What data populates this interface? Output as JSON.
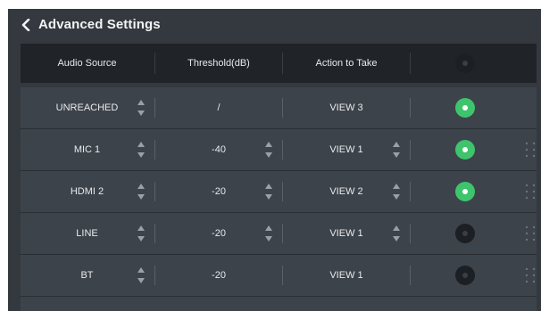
{
  "header": {
    "title": "Advanced Settings"
  },
  "table": {
    "columns": [
      "Audio Source",
      "Threshold(dB)",
      "Action to Take"
    ],
    "rows": [
      {
        "source": "UNREACHED",
        "threshold": "/",
        "action": "VIEW 3",
        "enabled": true
      },
      {
        "source": "MIC 1",
        "threshold": "-40",
        "action": "VIEW 1",
        "enabled": true
      },
      {
        "source": "HDMI 2",
        "threshold": "-20",
        "action": "VIEW 2",
        "enabled": true
      },
      {
        "source": "LINE",
        "threshold": "-20",
        "action": "VIEW 1",
        "enabled": false
      },
      {
        "source": "BT",
        "threshold": "-20",
        "action": "VIEW 1",
        "enabled": false
      }
    ]
  },
  "colors": {
    "accent_on": "#3ec46d",
    "background": "#34393f",
    "header_bg": "#202327",
    "row_bg": "#3d434a"
  }
}
